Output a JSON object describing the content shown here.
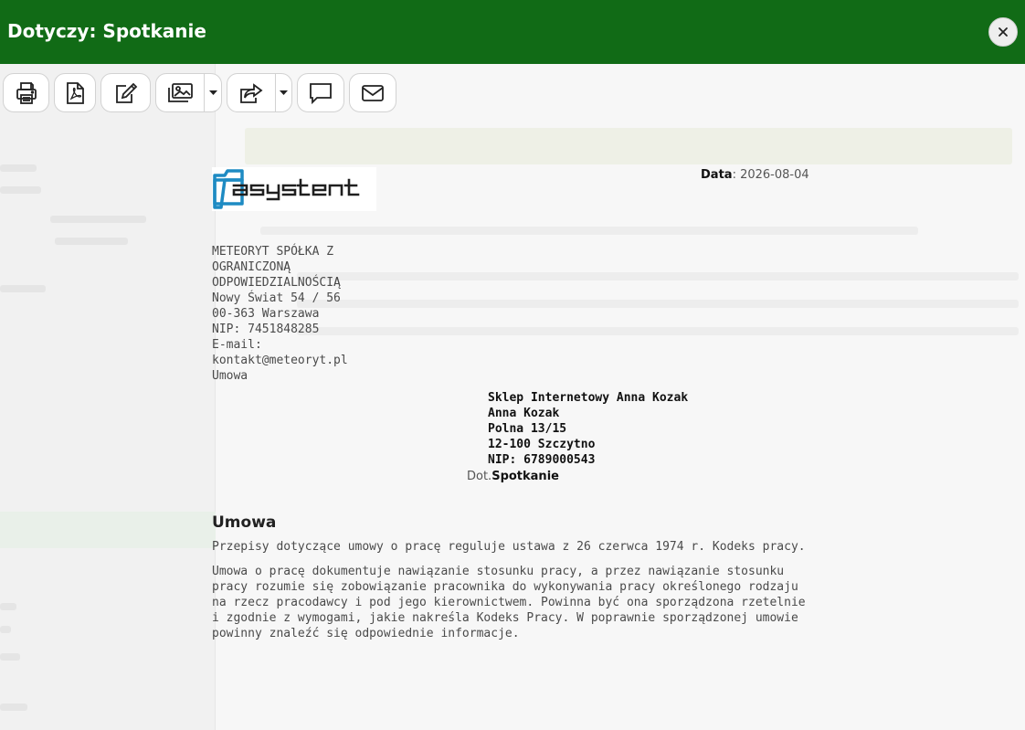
{
  "window": {
    "title": "Dotyczy: Spotkanie",
    "close_icon": "close-icon"
  },
  "colors": {
    "header_bg": "#116b16",
    "header_text": "#ffffff",
    "page_bg": "#f4f4f4",
    "logo_blue": "#1e8bc3"
  },
  "toolbar": {
    "items": [
      {
        "icon": "printer-icon"
      },
      {
        "icon": "pdf-icon"
      },
      {
        "icon": "edit-icon"
      },
      {
        "icon": "images-icon",
        "has_dropdown": true
      },
      {
        "icon": "share-icon",
        "has_dropdown": true
      },
      {
        "icon": "comment-icon"
      },
      {
        "icon": "envelope-icon"
      }
    ]
  },
  "document": {
    "logo_text": "asystent",
    "date_label": "Data",
    "date_value": "2026-08-04",
    "sender": {
      "name": "METEORYT SPÓŁKA Z OGRANICZONĄ ODPOWIEDZIALNOŚCIĄ",
      "street": "Nowy Świat 54 / 56",
      "city": "00-363 Warszawa",
      "nip": "NIP: 7451848285",
      "email_label": "E-mail:",
      "email": "kontakt@meteoryt.pl",
      "doc_type": "Umowa"
    },
    "recipient": {
      "company": "Sklep Internetowy Anna Kozak",
      "person": "Anna Kozak",
      "street": "Polna 13/15",
      "city": "12-100 Szczytno",
      "nip": "NIP: 6789000543"
    },
    "subject_prefix": "Dot.",
    "subject": "Spotkanie",
    "heading": "Umowa",
    "paragraph1": "Przepisy dotyczące umowy o pracę reguluje ustawa z 26 czerwca 1974 r. Kodeks pracy.",
    "paragraph2": "Umowa o pracę dokumentuje nawiązanie stosunku pracy, a przez nawiązanie stosunku pracy rozumie się zobowiązanie pracownika do wykonywania pracy określonego rodzaju na rzecz pracodawcy i pod jego kierownictwem. Powinna być ona sporządzona rzetelnie i zgodnie z wymogami, jakie nakreśla Kodeks Pracy. W poprawnie sporządzonej umowie powinny znaleźć się odpowiednie informacje."
  }
}
